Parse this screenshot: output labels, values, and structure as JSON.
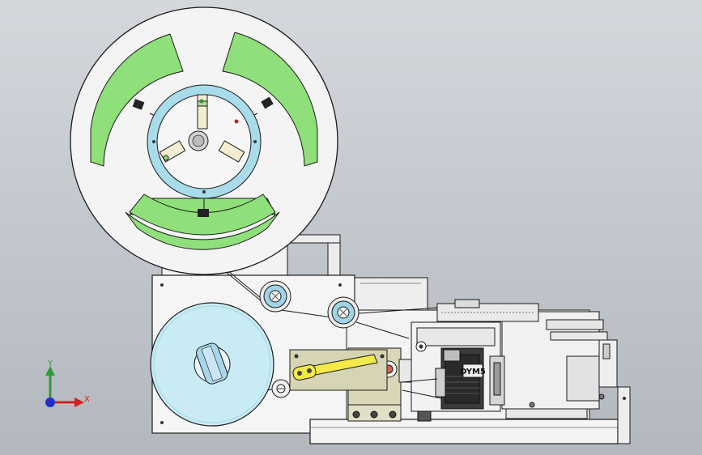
{
  "viewport": {
    "background_top": "#d4d8dd",
    "background_bottom": "#b3b8bf"
  },
  "axis_triad": {
    "y_label": "Y",
    "x_label": "X",
    "y_color": "#2e9a3a",
    "x_color": "#d02020",
    "z_color": "#2030c8"
  },
  "motor_label": {
    "text": "DYM5"
  },
  "colors": {
    "reel_disk": "#f4f4f4",
    "reel_window": "#8fe07a",
    "hub_ring": "#a8dcea",
    "tape_roll": "#c9ecf4",
    "frame": "#f5f5f5",
    "lever": "#d8d6a0",
    "outline": "#1a1a1a"
  }
}
